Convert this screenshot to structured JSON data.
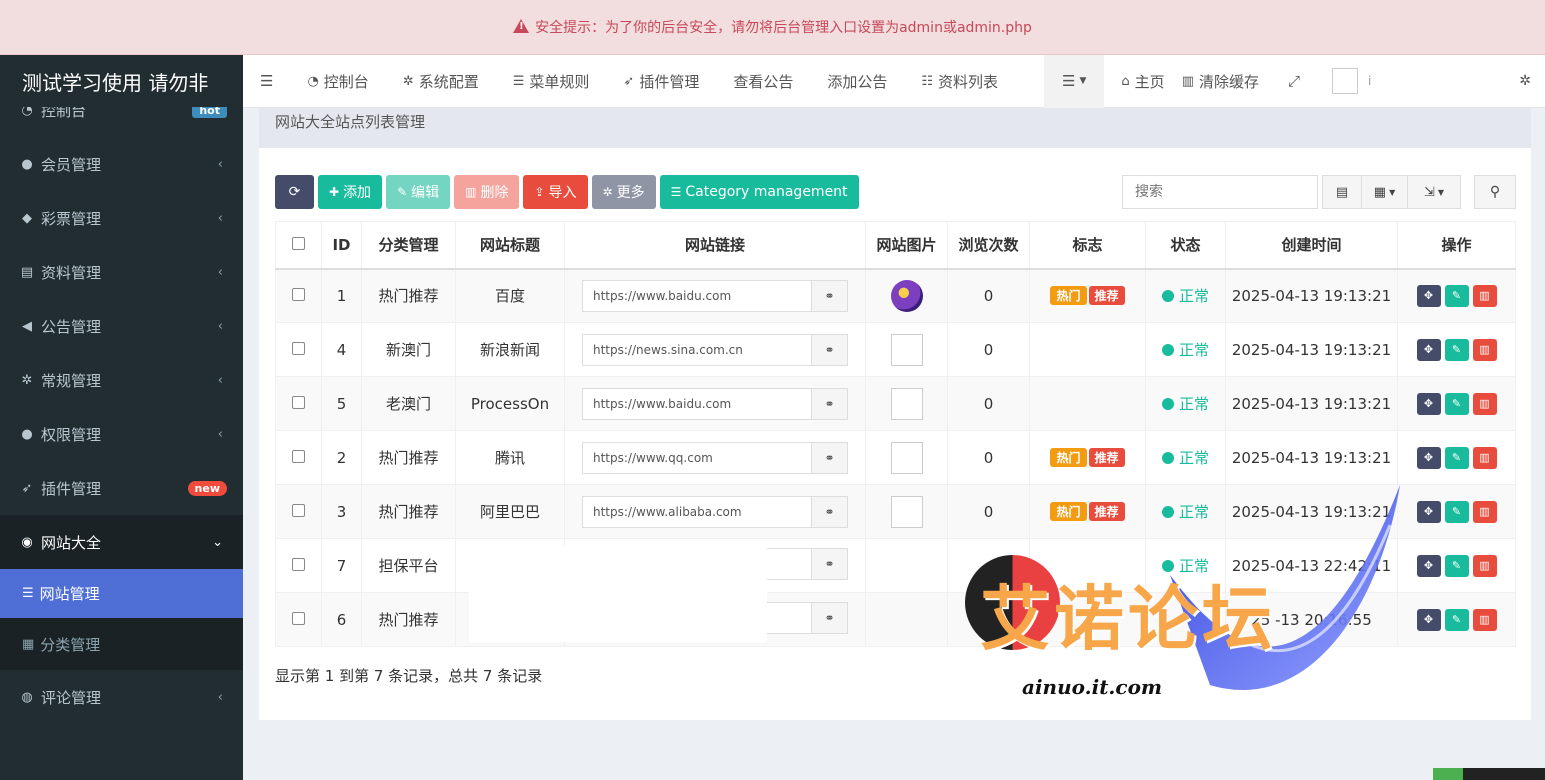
{
  "alert": {
    "text": "安全提示：为了你的后台安全，请勿将后台管理入口设置为admin或admin.php"
  },
  "sidebar": {
    "brand": "测试学习使用 请勿非",
    "items": [
      {
        "label": "控制台",
        "icon": "dashboard-icon",
        "badge": "hot"
      },
      {
        "label": "会员管理",
        "icon": "user-icon"
      },
      {
        "label": "彩票管理",
        "icon": "tag-icon"
      },
      {
        "label": "资料管理",
        "icon": "file-icon"
      },
      {
        "label": "公告管理",
        "icon": "bullhorn-icon"
      },
      {
        "label": "常规管理",
        "icon": "cogs-icon"
      },
      {
        "label": "权限管理",
        "icon": "group-icon"
      },
      {
        "label": "插件管理",
        "icon": "rocket-icon",
        "badge": "new"
      },
      {
        "label": "网站大全",
        "icon": "globe-icon"
      },
      {
        "label": "评论管理",
        "icon": "comments-icon"
      }
    ],
    "sub": [
      {
        "label": "网站管理",
        "icon": "list-icon"
      },
      {
        "label": "分类管理",
        "icon": "grid-icon"
      }
    ]
  },
  "navbar": {
    "items": [
      {
        "label": "控制台",
        "icon": "dashboard-icon"
      },
      {
        "label": "系统配置",
        "icon": "gear-icon"
      },
      {
        "label": "菜单规则",
        "icon": "bars-icon"
      },
      {
        "label": "插件管理",
        "icon": "rocket-icon"
      },
      {
        "label": "查看公告"
      },
      {
        "label": "添加公告"
      },
      {
        "label": "资料列表",
        "icon": "list-icon"
      }
    ],
    "home": "主页",
    "clear_cache": "清除缓存",
    "dot": "i"
  },
  "content": {
    "title": "网站大全站点列表管理",
    "toolbar": {
      "add": "添加",
      "edit": "编辑",
      "delete": "删除",
      "import": "导入",
      "more": "更多",
      "category": "Category management"
    },
    "search_placeholder": "搜索",
    "columns": [
      "ID",
      "分类管理",
      "网站标题",
      "网站链接",
      "网站图片",
      "浏览次数",
      "标志",
      "状态",
      "创建时间",
      "操作"
    ],
    "tags": {
      "hot": "热门",
      "rec": "推荐"
    },
    "rows": [
      {
        "id": "1",
        "category": "热门推荐",
        "title": "百度",
        "url": "https://www.baidu.com",
        "views": "0",
        "tags": true,
        "status": "正常",
        "created": "2025-04-13 19:13:21"
      },
      {
        "id": "4",
        "category": "新澳门",
        "title": "新浪新闻",
        "url": "https://news.sina.com.cn",
        "views": "0",
        "tags": false,
        "status": "正常",
        "created": "2025-04-13 19:13:21"
      },
      {
        "id": "5",
        "category": "老澳门",
        "title": "ProcessOn",
        "url": "https://www.baidu.com",
        "views": "0",
        "tags": false,
        "status": "正常",
        "created": "2025-04-13 19:13:21"
      },
      {
        "id": "2",
        "category": "热门推荐",
        "title": "腾讯",
        "url": "https://www.qq.com",
        "views": "0",
        "tags": true,
        "status": "正常",
        "created": "2025-04-13 19:13:21"
      },
      {
        "id": "3",
        "category": "热门推荐",
        "title": "阿里巴巴",
        "url": "https://www.alibaba.com",
        "views": "0",
        "tags": true,
        "status": "正常",
        "created": "2025-04-13 19:13:21"
      },
      {
        "id": "7",
        "category": "担保平台",
        "title": "",
        "url": "",
        "views": "",
        "tags": false,
        "status": "正常",
        "created": "2025-04-13 22:42:11"
      },
      {
        "id": "6",
        "category": "热门推荐",
        "title": "",
        "url": "",
        "views": "0",
        "tags": false,
        "status": "",
        "created": "25  -13 20:16:55"
      }
    ],
    "footer": "显示第 1 到第 7 条记录，总共 7 条记录"
  },
  "watermark": {
    "text": "艾诺论坛",
    "url": "ainuo.it.com"
  }
}
